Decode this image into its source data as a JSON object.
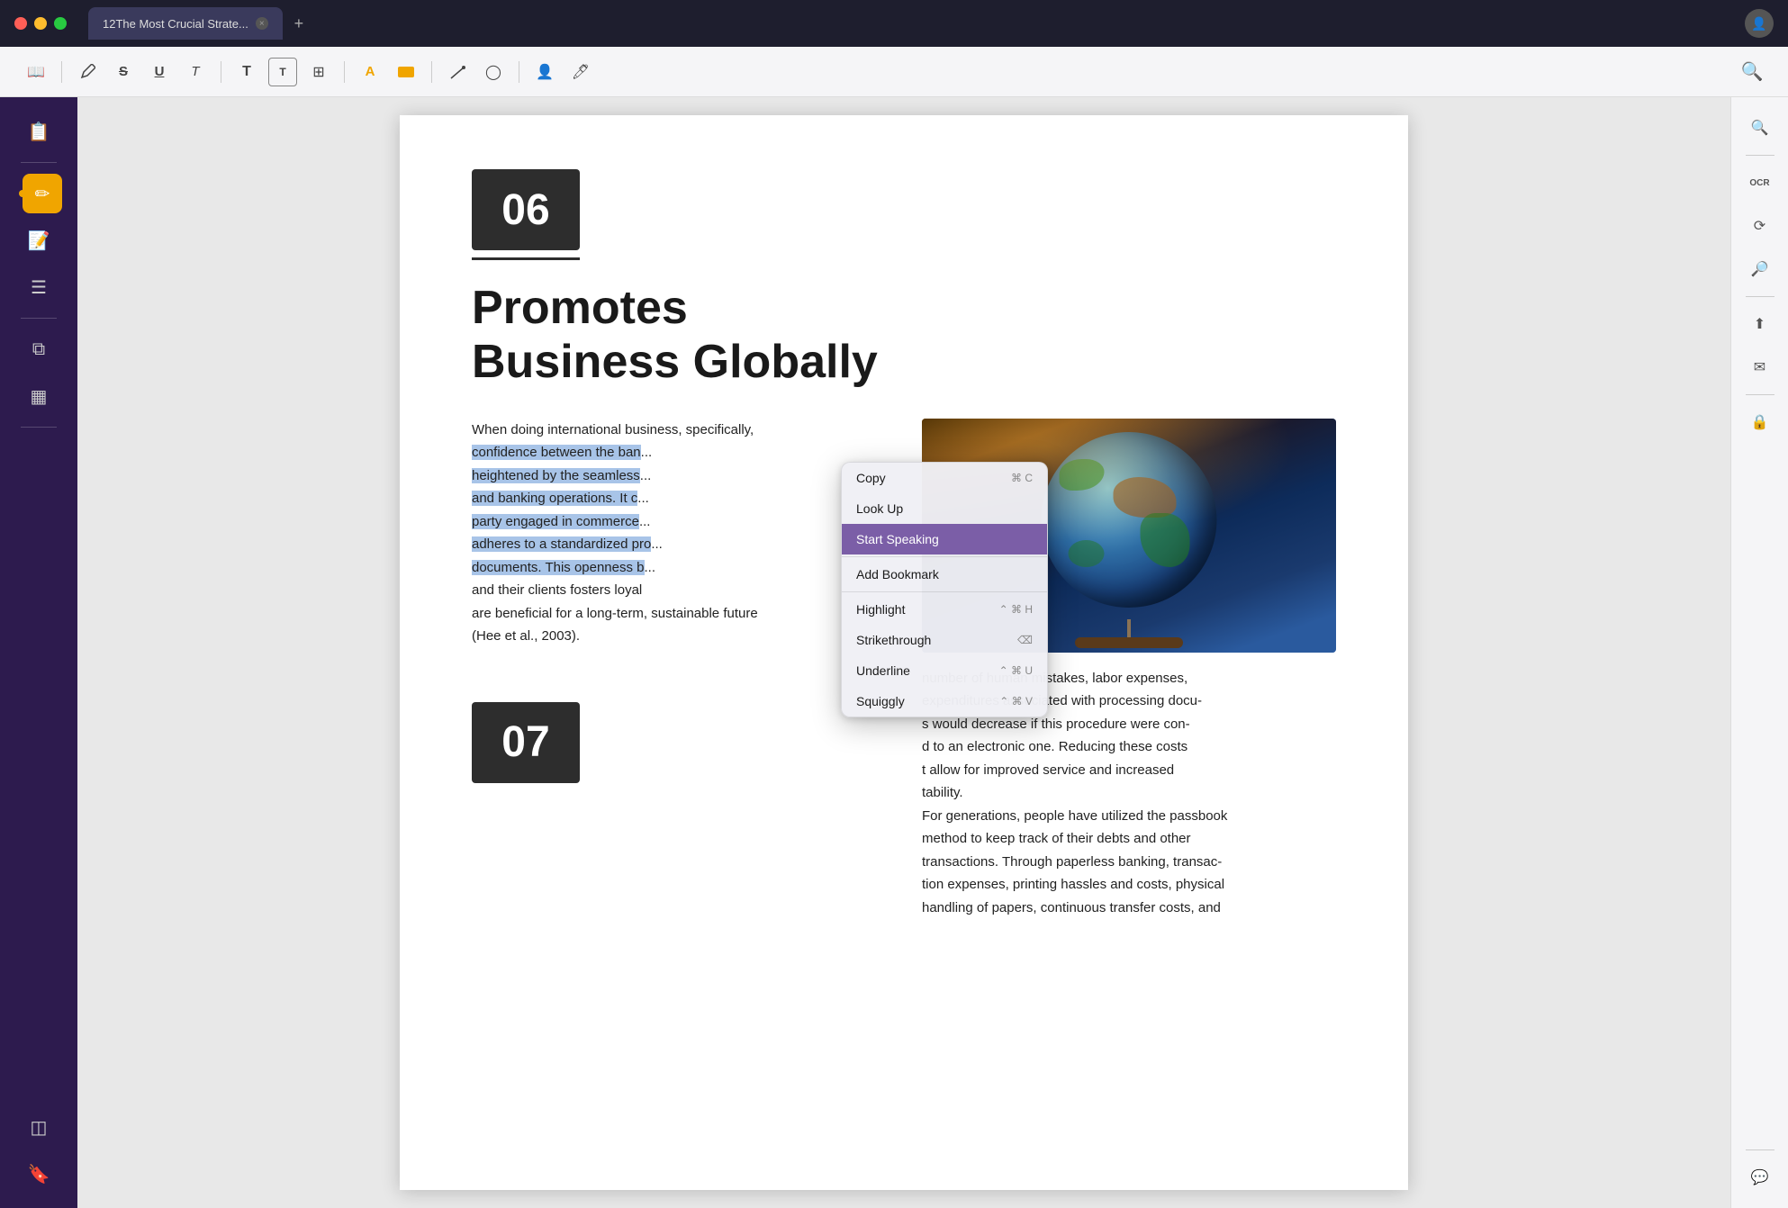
{
  "titlebar": {
    "tab_label": "12The Most Crucial Strate...",
    "close_symbol": "✕",
    "add_symbol": "+"
  },
  "toolbar": {
    "icons": [
      {
        "name": "reading-mode-icon",
        "symbol": "📖"
      },
      {
        "name": "pen-icon",
        "symbol": "✒"
      },
      {
        "name": "strikethrough-icon",
        "symbol": "S"
      },
      {
        "name": "underline-icon",
        "symbol": "U"
      },
      {
        "name": "text-underline-icon",
        "symbol": "T"
      },
      {
        "name": "text-bold-icon",
        "symbol": "T"
      },
      {
        "name": "text-box-icon",
        "symbol": "T"
      },
      {
        "name": "table-icon",
        "symbol": "⊞"
      },
      {
        "name": "highlight-icon",
        "symbol": "A"
      },
      {
        "name": "color-fill-icon",
        "symbol": "▬"
      },
      {
        "name": "draw-icon",
        "symbol": "✏"
      },
      {
        "name": "shape-icon",
        "symbol": "◯"
      },
      {
        "name": "person-icon",
        "symbol": "👤"
      },
      {
        "name": "stamp-icon",
        "symbol": "🖊"
      }
    ]
  },
  "left_sidebar": {
    "icons": [
      {
        "name": "document-icon",
        "symbol": "📋",
        "active": false
      },
      {
        "name": "pen-tool-icon",
        "symbol": "✏",
        "active": true
      },
      {
        "name": "notes-icon",
        "symbol": "📝",
        "active": false
      },
      {
        "name": "list-icon",
        "symbol": "☰",
        "active": false
      },
      {
        "name": "copy-doc-icon",
        "symbol": "⧉",
        "active": false
      },
      {
        "name": "template-icon",
        "symbol": "▦",
        "active": false
      },
      {
        "name": "layers-icon",
        "symbol": "◫",
        "active": false
      },
      {
        "name": "bookmark-icon",
        "symbol": "🔖",
        "active": false
      }
    ]
  },
  "right_sidebar": {
    "icons": [
      {
        "name": "search-icon",
        "symbol": "🔍"
      },
      {
        "name": "ocr-icon",
        "symbol": "OCR"
      },
      {
        "name": "scan-icon",
        "symbol": "⟳"
      },
      {
        "name": "search-doc-icon",
        "symbol": "🔎"
      },
      {
        "name": "share-icon",
        "symbol": "⬆"
      },
      {
        "name": "mail-icon",
        "symbol": "✉"
      },
      {
        "name": "protect-icon",
        "symbol": "🔒"
      },
      {
        "name": "comment-icon",
        "symbol": "💬"
      }
    ]
  },
  "page": {
    "section_number": "06",
    "section_number2": "07",
    "heading_line1": "Promotes",
    "heading_line2": "Business Globally",
    "body_left_normal": "When doing international business, specifically,",
    "body_left_highlighted": "confidence between the ban",
    "body_left_highlighted2": "heightened by the seamless",
    "body_left_more": "and banking operations. It c",
    "body_left_more2": "party engaged in commerce",
    "body_left_more3": "adheres to a standardized pro",
    "body_left_more4": "documents. This openness b",
    "body_left_end": "and their clients fosters loyal",
    "body_left_end2": "are beneficial for a long-term, sustainable future",
    "body_left_end3": "(Hee et al., 2003).",
    "right_col_text1": "number of human mistakes, labor expenses,",
    "right_col_text2": "expenditures associated with processing docu-",
    "right_col_text3": "s would decrease if this procedure were con-",
    "right_col_text4": "d to an electronic one. Reducing these costs",
    "right_col_text5": "t allow for improved service and increased",
    "right_col_text6": "tability.",
    "right_col_text7": "For generations, people have utilized the passbook",
    "right_col_text8": "method to keep track of their debts and other",
    "right_col_text9": "transactions. Through paperless banking, transac-",
    "right_col_text10": "tion expenses, printing hassles and costs, physical",
    "right_col_text11": "handling of papers, continuous transfer costs, and"
  },
  "context_menu": {
    "items": [
      {
        "label": "Copy",
        "shortcut": "⌘ C",
        "active": false
      },
      {
        "label": "Look Up",
        "shortcut": "",
        "active": false
      },
      {
        "label": "Start Speaking",
        "shortcut": "",
        "active": true
      },
      {
        "label": "Add Bookmark",
        "shortcut": "",
        "active": false
      },
      {
        "label": "Highlight",
        "shortcut": "⌃ ⌘ H",
        "active": false
      },
      {
        "label": "Strikethrough",
        "shortcut": "⌫",
        "active": false
      },
      {
        "label": "Underline",
        "shortcut": "⌃ ⌘ U",
        "active": false
      },
      {
        "label": "Squiggly",
        "shortcut": "⌃ ⌘ V",
        "active": false
      }
    ]
  }
}
